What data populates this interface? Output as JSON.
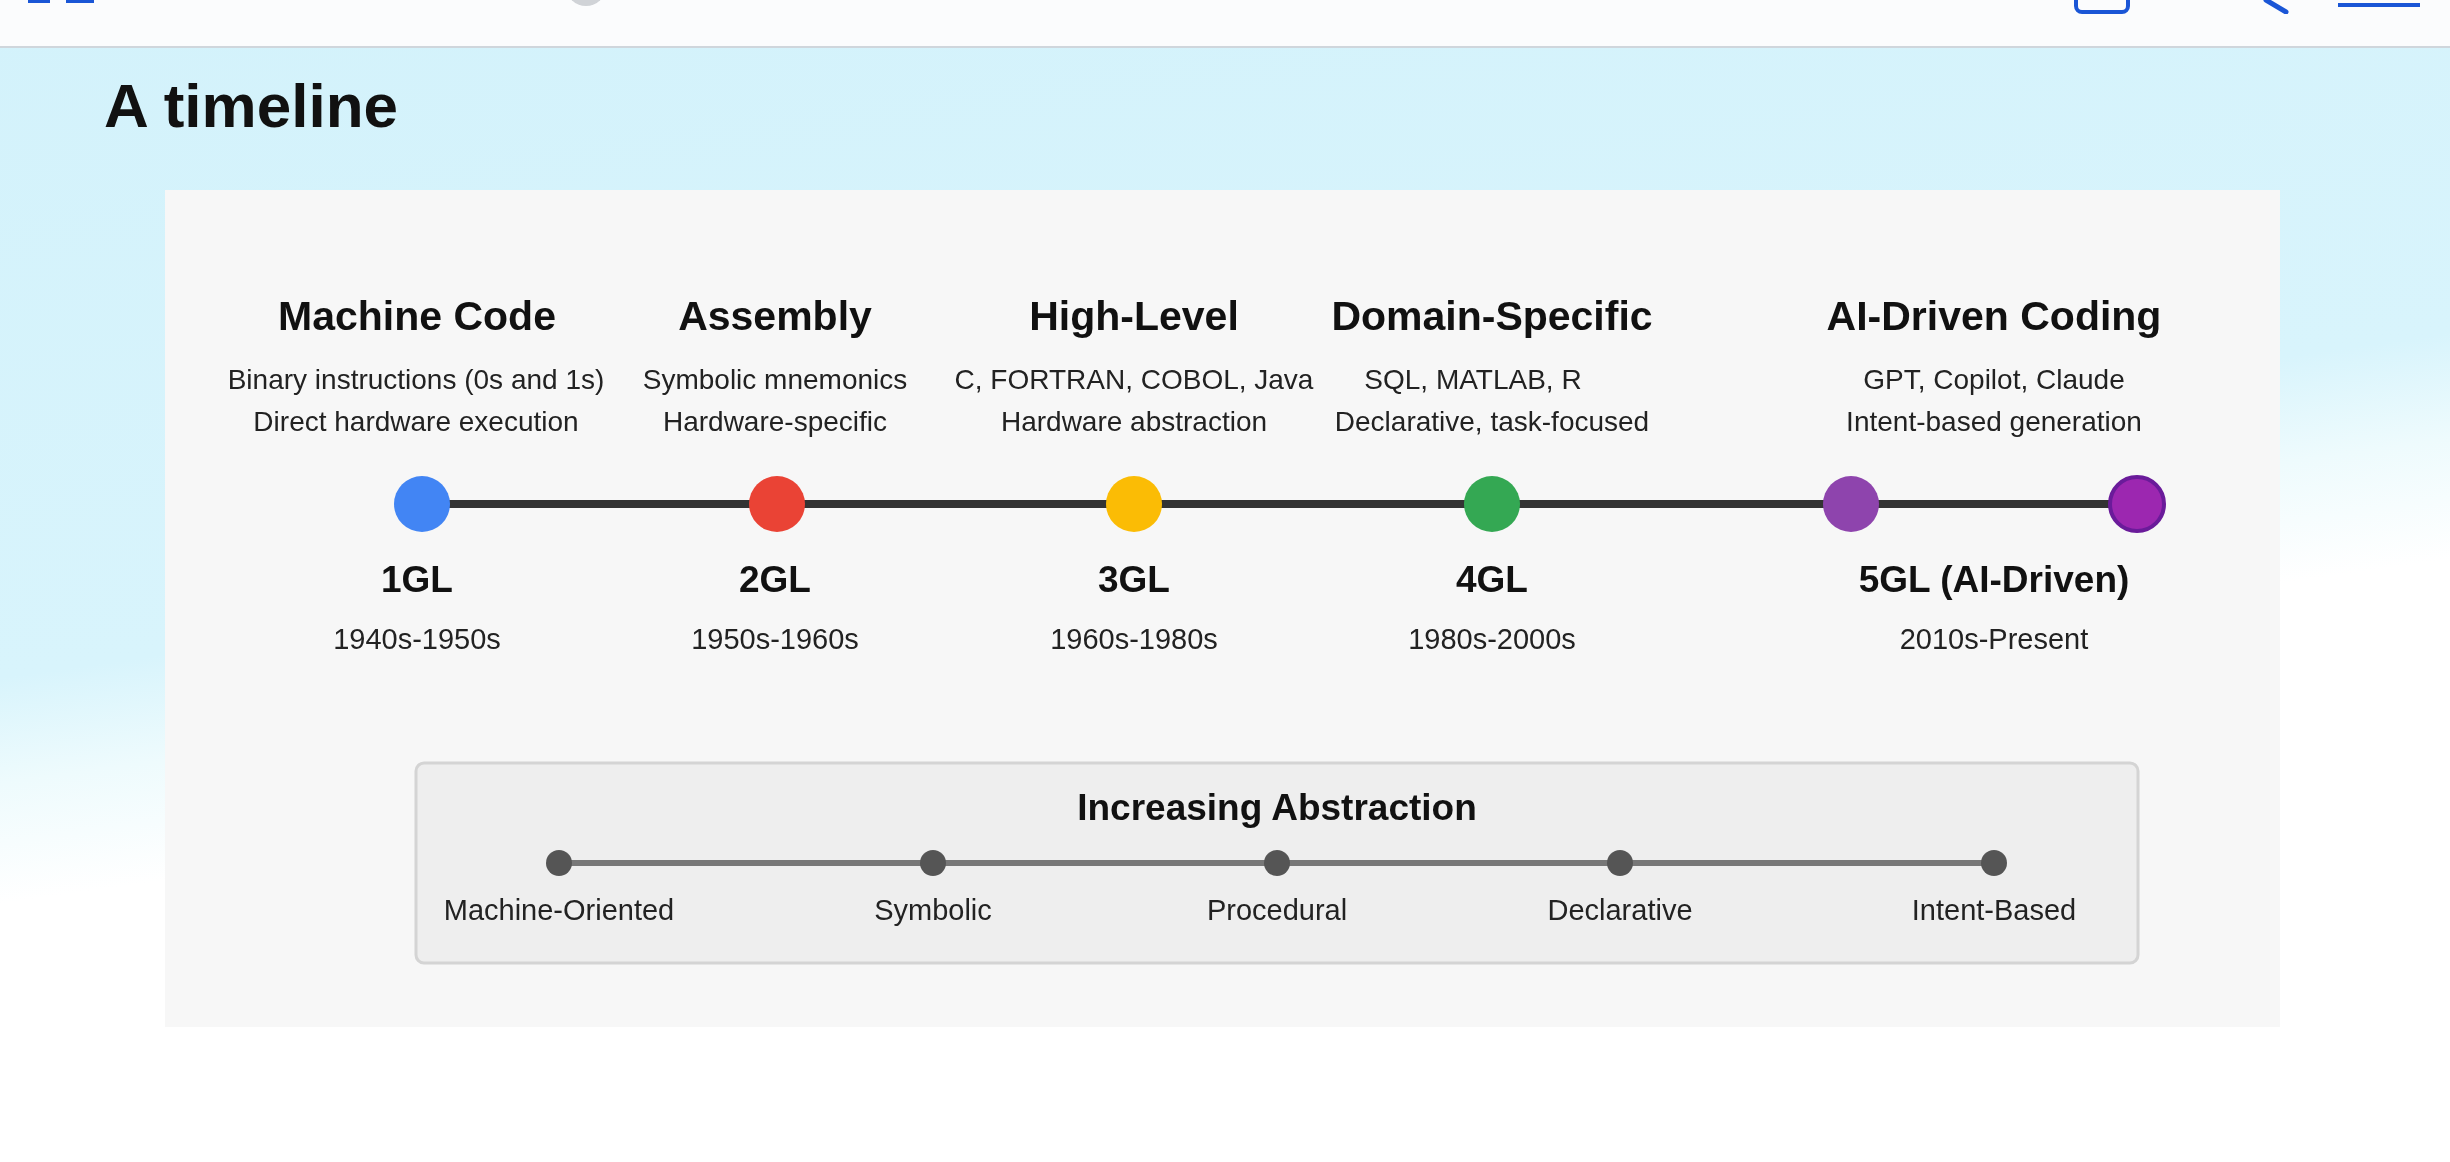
{
  "heading": "A timeline",
  "generations": [
    {
      "title": "Machine Code",
      "lines": [
        "Binary instructions (0s and 1s)",
        "Direct hardware execution"
      ],
      "label": "1GL",
      "years": "1940s-1950s",
      "color": "#4285f4"
    },
    {
      "title": "Assembly",
      "lines": [
        "Symbolic mnemonics",
        "Hardware-specific"
      ],
      "label": "2GL",
      "years": "1950s-1960s",
      "color": "#ea4335"
    },
    {
      "title": "High-Level",
      "lines": [
        "C, FORTRAN, COBOL, Java",
        "Hardware abstraction"
      ],
      "label": "3GL",
      "years": "1960s-1980s",
      "color": "#fbbc05"
    },
    {
      "title": "Domain-Specific",
      "lines": [
        "SQL, MATLAB, R",
        "Declarative, task-focused"
      ],
      "label": "4GL",
      "years": "1980s-2000s",
      "color": "#34a853"
    },
    {
      "title": "AI-Driven Coding",
      "lines": [
        "GPT, Copilot, Claude",
        "Intent-based generation"
      ],
      "label": "5GL (AI-Driven)",
      "years": "2010s-Present",
      "color": "#8e44ad"
    }
  ],
  "end_marker": {
    "color": "#9c27b0"
  },
  "abstraction": {
    "title": "Increasing Abstraction",
    "stages": [
      "Machine-Oriented",
      "Symbolic",
      "Procedural",
      "Declarative",
      "Intent-Based"
    ]
  }
}
